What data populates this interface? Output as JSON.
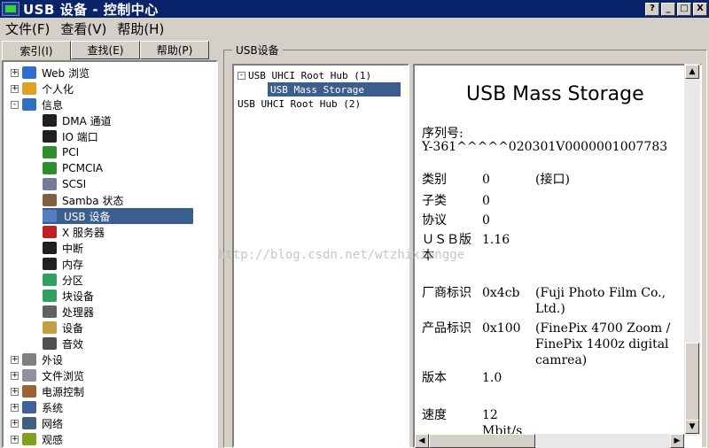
{
  "window": {
    "title": "USB 设备 - 控制中心",
    "buttons": [
      "?",
      "_",
      "□",
      "X"
    ]
  },
  "menu": [
    "文件(F)",
    "查看(V)",
    "帮助(H)"
  ],
  "tabs": [
    "索引(I)",
    "查找(E)",
    "帮助(P)"
  ],
  "tree": [
    {
      "label": "Web 浏览",
      "exp": "+",
      "icon": "globe-icon",
      "level": 0
    },
    {
      "label": "个人化",
      "exp": "+",
      "icon": "user-icon",
      "level": 0
    },
    {
      "label": "信息",
      "exp": "-",
      "icon": "info-icon",
      "level": 0
    },
    {
      "label": "DMA 通道",
      "icon": "chip-icon",
      "level": 1
    },
    {
      "label": "IO 端口",
      "icon": "chip-icon",
      "level": 1
    },
    {
      "label": "PCI",
      "icon": "card-icon",
      "level": 1
    },
    {
      "label": "PCMCIA",
      "icon": "card-icon",
      "level": 1
    },
    {
      "label": "SCSI",
      "icon": "scsi-icon",
      "level": 1
    },
    {
      "label": "Samba 状态",
      "icon": "samba-icon",
      "level": 1
    },
    {
      "label": "USB 设备",
      "icon": "usb-icon",
      "level": 1,
      "selected": true
    },
    {
      "label": "X 服务器",
      "icon": "x-icon",
      "level": 1
    },
    {
      "label": "中断",
      "icon": "chip-icon",
      "level": 1
    },
    {
      "label": "内存",
      "icon": "chip-icon",
      "level": 1
    },
    {
      "label": "分区",
      "icon": "partition-icon",
      "level": 1
    },
    {
      "label": "块设备",
      "icon": "partition-icon",
      "level": 1
    },
    {
      "label": "处理器",
      "icon": "cpu-icon",
      "level": 1
    },
    {
      "label": "设备",
      "icon": "device-icon",
      "level": 1
    },
    {
      "label": "音效",
      "icon": "sound-icon",
      "level": 1
    },
    {
      "label": "外设",
      "exp": "+",
      "icon": "mouse-icon",
      "level": 0
    },
    {
      "label": "文件浏览",
      "exp": "+",
      "icon": "file-icon",
      "level": 0
    },
    {
      "label": "电源控制",
      "exp": "+",
      "icon": "power-icon",
      "level": 0
    },
    {
      "label": "系统",
      "exp": "+",
      "icon": "system-icon",
      "level": 0
    },
    {
      "label": "网络",
      "exp": "+",
      "icon": "network-icon",
      "level": 0
    },
    {
      "label": "观感",
      "exp": "+",
      "icon": "appearance-icon",
      "level": 0
    }
  ],
  "group_label": "USB设备",
  "devices": [
    {
      "label": "USB UHCI Root Hub (1)",
      "exp": "-",
      "level": 0
    },
    {
      "label": "USB Mass Storage",
      "level": 1,
      "selected": true
    },
    {
      "label": "USB UHCI Root Hub (2)",
      "level": 0
    }
  ],
  "detail": {
    "heading": "USB Mass Storage",
    "serial_label": "序列号:",
    "serial_value": "Y-361^^^^^020301V0000001007783",
    "rows": [
      {
        "label": "类别",
        "value": "0",
        "extra": "(接口)"
      },
      {
        "label": "子类",
        "value": "0",
        "extra": ""
      },
      {
        "label": "协议",
        "value": "0",
        "extra": ""
      },
      {
        "label": "ＵＳＢ版本",
        "value": "1.16",
        "extra": ""
      },
      {
        "label": "厂商标识",
        "value": "0x4cb",
        "extra": "(Fuji Photo Film Co., Ltd.)"
      },
      {
        "label": "产品标识",
        "value": "0x100",
        "extra": "(FinePix 4700 Zoom / FinePix 1400z digital camrea)"
      },
      {
        "label": "版本",
        "value": "1.0",
        "extra": ""
      },
      {
        "label": "速度",
        "value": "12 Mbit/s",
        "extra": ""
      }
    ]
  },
  "watermark": "http://blog.csdn.net/wtzhixiongge",
  "colors": {
    "titlebar": "#0a246a",
    "selection": "#3a5f8f",
    "face": "#d4d0c8"
  }
}
